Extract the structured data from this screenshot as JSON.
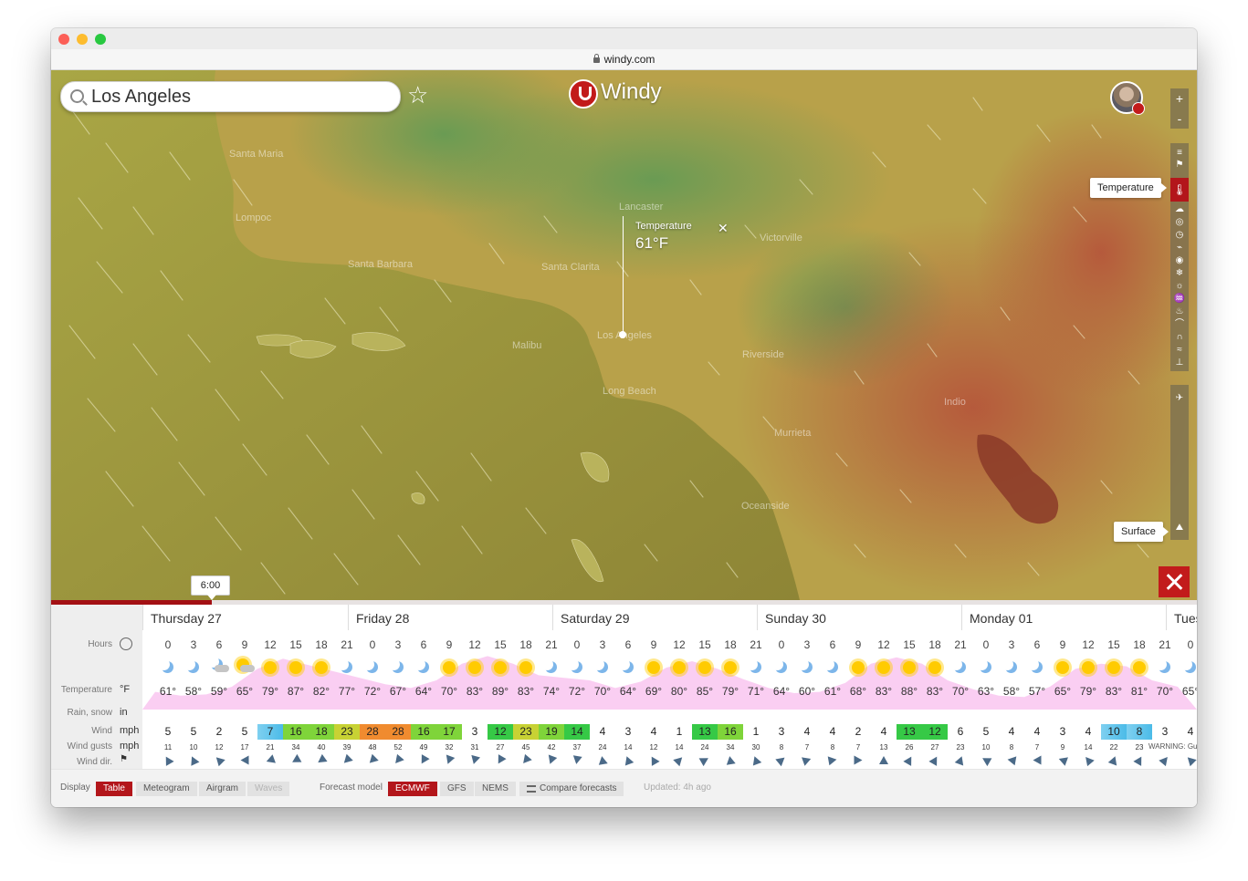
{
  "browser": {
    "url": "windy.com"
  },
  "header": {
    "search_value": "Los Angeles",
    "logo_text": "Windy"
  },
  "map": {
    "tooltips": {
      "temperature": "Temperature",
      "surface": "Surface"
    },
    "picker": {
      "label": "Temperature",
      "value": "61°F"
    },
    "zoom": {
      "in": "+",
      "out": "-"
    },
    "places": [
      "Santa Maria",
      "Lompoc",
      "Santa Barbara",
      "Lancaster",
      "Victorville",
      "Santa Clarita",
      "Malibu",
      "Los Angeles",
      "Riverside",
      "Long Beach",
      "Murrieta",
      "Indio",
      "Oceanside"
    ]
  },
  "timeline": {
    "time": "6:00",
    "progress": 0.14
  },
  "forecast": {
    "labels": {
      "hours": "Hours",
      "temperature": "Temperature",
      "temp_unit": "°F",
      "rain": "Rain, snow",
      "rain_unit": "in",
      "wind": "Wind",
      "wind_unit": "mph",
      "gusts": "Wind gusts",
      "gusts_unit": "mph",
      "dir": "Wind dir."
    },
    "days": [
      "Thursday 27",
      "Friday 28",
      "Saturday 29",
      "Sunday 30",
      "Monday 01",
      "Tues"
    ],
    "hours": [
      "0",
      "3",
      "6",
      "9",
      "12",
      "15",
      "18",
      "21",
      "0",
      "3",
      "6",
      "9",
      "12",
      "15",
      "18",
      "21",
      "0",
      "3",
      "6",
      "9",
      "12",
      "15",
      "18",
      "21",
      "0",
      "3",
      "6",
      "9",
      "12",
      "15",
      "18",
      "21",
      "0",
      "3",
      "6",
      "9",
      "12",
      "15",
      "18",
      "21",
      "0"
    ],
    "weather": [
      "moon",
      "moon",
      "cloud-moon",
      "cloud-sun",
      "sun",
      "sun",
      "sun",
      "moon",
      "moon",
      "moon",
      "moon",
      "sun",
      "sun",
      "sun",
      "sun",
      "moon",
      "moon",
      "moon",
      "moon",
      "sun",
      "sun",
      "sun",
      "sun",
      "moon",
      "moon",
      "moon",
      "moon",
      "sun",
      "sun",
      "sun",
      "sun",
      "moon",
      "moon",
      "moon",
      "moon",
      "sun",
      "sun",
      "sun",
      "sun",
      "moon",
      "moon"
    ],
    "temperatures": [
      "61°",
      "58°",
      "59°",
      "65°",
      "79°",
      "87°",
      "82°",
      "77°",
      "72°",
      "67°",
      "64°",
      "70°",
      "83°",
      "89°",
      "83°",
      "74°",
      "72°",
      "70°",
      "64°",
      "69°",
      "80°",
      "85°",
      "79°",
      "71°",
      "64°",
      "60°",
      "61°",
      "68°",
      "83°",
      "88°",
      "83°",
      "70°",
      "63°",
      "58°",
      "57°",
      "65°",
      "79°",
      "83°",
      "81°",
      "70°",
      "65°"
    ],
    "wind": [
      "5",
      "5",
      "2",
      "5",
      "7",
      "16",
      "18",
      "23",
      "28",
      "28",
      "16",
      "17",
      "3",
      "12",
      "23",
      "19",
      "14",
      "4",
      "3",
      "4",
      "1",
      "13",
      "16",
      "1",
      "3",
      "4",
      "4",
      "2",
      "4",
      "13",
      "12",
      "6",
      "5",
      "4",
      "4",
      "3",
      "4",
      "10",
      "8",
      "3",
      "4"
    ],
    "gusts": [
      "11",
      "10",
      "12",
      "17",
      "21",
      "34",
      "40",
      "39",
      "48",
      "52",
      "49",
      "32",
      "31",
      "27",
      "45",
      "42",
      "37",
      "24",
      "14",
      "12",
      "14",
      "24",
      "34",
      "30",
      "8",
      "7",
      "8",
      "7",
      "13",
      "26",
      "27",
      "23",
      "10",
      "8",
      "7",
      "9",
      "14",
      "22",
      "23",
      "",
      ""
    ],
    "warning": "WARNING: Gu"
  },
  "footer": {
    "display_label": "Display",
    "display_options": [
      "Table",
      "Meteogram",
      "Airgram",
      "Waves"
    ],
    "model_label": "Forecast model",
    "models": [
      "ECMWF",
      "GFS",
      "NEMS"
    ],
    "compare": "Compare forecasts",
    "updated": "Updated: 4h ago"
  },
  "colors": {
    "brand_red": "#b3161b",
    "map_olive": "#a8a147",
    "map_red": "#a64a33",
    "temp_band": "#f6a6e8"
  }
}
